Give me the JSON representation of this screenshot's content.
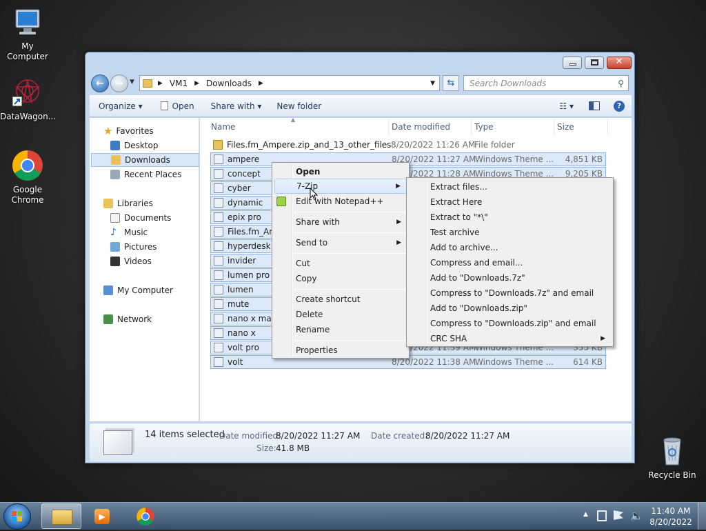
{
  "desktop": {
    "icons": [
      {
        "label": "My Computer",
        "icon": "computer-icon"
      },
      {
        "label": "DataWagon...",
        "icon": "datawagon-icon"
      },
      {
        "label": "Google Chrome",
        "icon": "chrome-icon"
      },
      {
        "label": "Recycle Bin",
        "icon": "recycle-bin-icon"
      }
    ]
  },
  "window": {
    "breadcrumb": [
      "VM1",
      "Downloads"
    ],
    "search_placeholder": "Search Downloads",
    "toolbar": {
      "organize": "Organize",
      "open": "Open",
      "share_with": "Share with",
      "new_folder": "New folder"
    }
  },
  "nav": {
    "favorites": "Favorites",
    "fav_items": [
      "Desktop",
      "Downloads",
      "Recent Places"
    ],
    "libraries": "Libraries",
    "lib_items": [
      "Documents",
      "Music",
      "Pictures",
      "Videos"
    ],
    "my_computer": "My Computer",
    "network": "Network"
  },
  "columns": {
    "name": "Name",
    "date": "Date modified",
    "type": "Type",
    "size": "Size"
  },
  "files": [
    {
      "name": "Files.fm_Ampere.zip_and_13_other_files",
      "date": "8/20/2022 11:26 AM",
      "type": "File folder",
      "size": "",
      "selected": false
    },
    {
      "name": "ampere",
      "date": "8/20/2022 11:27 AM",
      "type": "Windows Theme ...",
      "size": "4,851 KB",
      "selected": true
    },
    {
      "name": "concept",
      "date": "8/20/2022 11:28 AM",
      "type": "Windows Theme ...",
      "size": "9,205 KB",
      "selected": true
    },
    {
      "name": "cyber",
      "date": "",
      "type": "",
      "size": "",
      "selected": true
    },
    {
      "name": "dynamic",
      "date": "",
      "type": "",
      "size": "",
      "selected": true
    },
    {
      "name": "epix pro",
      "date": "",
      "type": "",
      "size": "",
      "selected": true
    },
    {
      "name": "Files.fm_Am",
      "date": "",
      "type": "",
      "size": "",
      "selected": true
    },
    {
      "name": "hyperdesk",
      "date": "",
      "type": "",
      "size": "",
      "selected": true
    },
    {
      "name": "invider",
      "date": "",
      "type": "",
      "size": "",
      "selected": true
    },
    {
      "name": "lumen pro",
      "date": "",
      "type": "",
      "size": "",
      "selected": true
    },
    {
      "name": "lumen",
      "date": "",
      "type": "",
      "size": "",
      "selected": true
    },
    {
      "name": "mute",
      "date": "",
      "type": "",
      "size": "",
      "selected": true
    },
    {
      "name": "nano x max",
      "date": "",
      "type": "",
      "size": "",
      "selected": true
    },
    {
      "name": "nano x",
      "date": "",
      "type": "",
      "size": "",
      "selected": true
    },
    {
      "name": "volt pro",
      "date": "8/20/2022 11:39 AM",
      "type": "Windows Theme ...",
      "size": "355 KB",
      "selected": true
    },
    {
      "name": "volt",
      "date": "8/20/2022 11:38 AM",
      "type": "Windows Theme ...",
      "size": "614 KB",
      "selected": true
    }
  ],
  "details": {
    "count": "14 items selected",
    "date_modified_label": "Date modified:",
    "date_modified": "8/20/2022 11:27 AM",
    "date_created_label": "Date created:",
    "date_created": "8/20/2022 11:27 AM",
    "size_label": "Size:",
    "size": "41.8 MB"
  },
  "context_menu": {
    "open": "Open",
    "seven_zip": "7-Zip",
    "edit_notepad": "Edit with Notepad++",
    "share_with": "Share with",
    "send_to": "Send to",
    "cut": "Cut",
    "copy": "Copy",
    "create_shortcut": "Create shortcut",
    "delete": "Delete",
    "rename": "Rename",
    "properties": "Properties"
  },
  "zip_menu": [
    "Extract files...",
    "Extract Here",
    "Extract to \"*\\\"",
    "Test archive",
    "Add to archive...",
    "Compress and email...",
    "Add to \"Downloads.7z\"",
    "Compress to \"Downloads.7z\" and email",
    "Add to \"Downloads.zip\"",
    "Compress to \"Downloads.zip\" and email",
    "CRC SHA"
  ],
  "taskbar": {
    "time": "11:40 AM",
    "date": "8/20/2022"
  }
}
